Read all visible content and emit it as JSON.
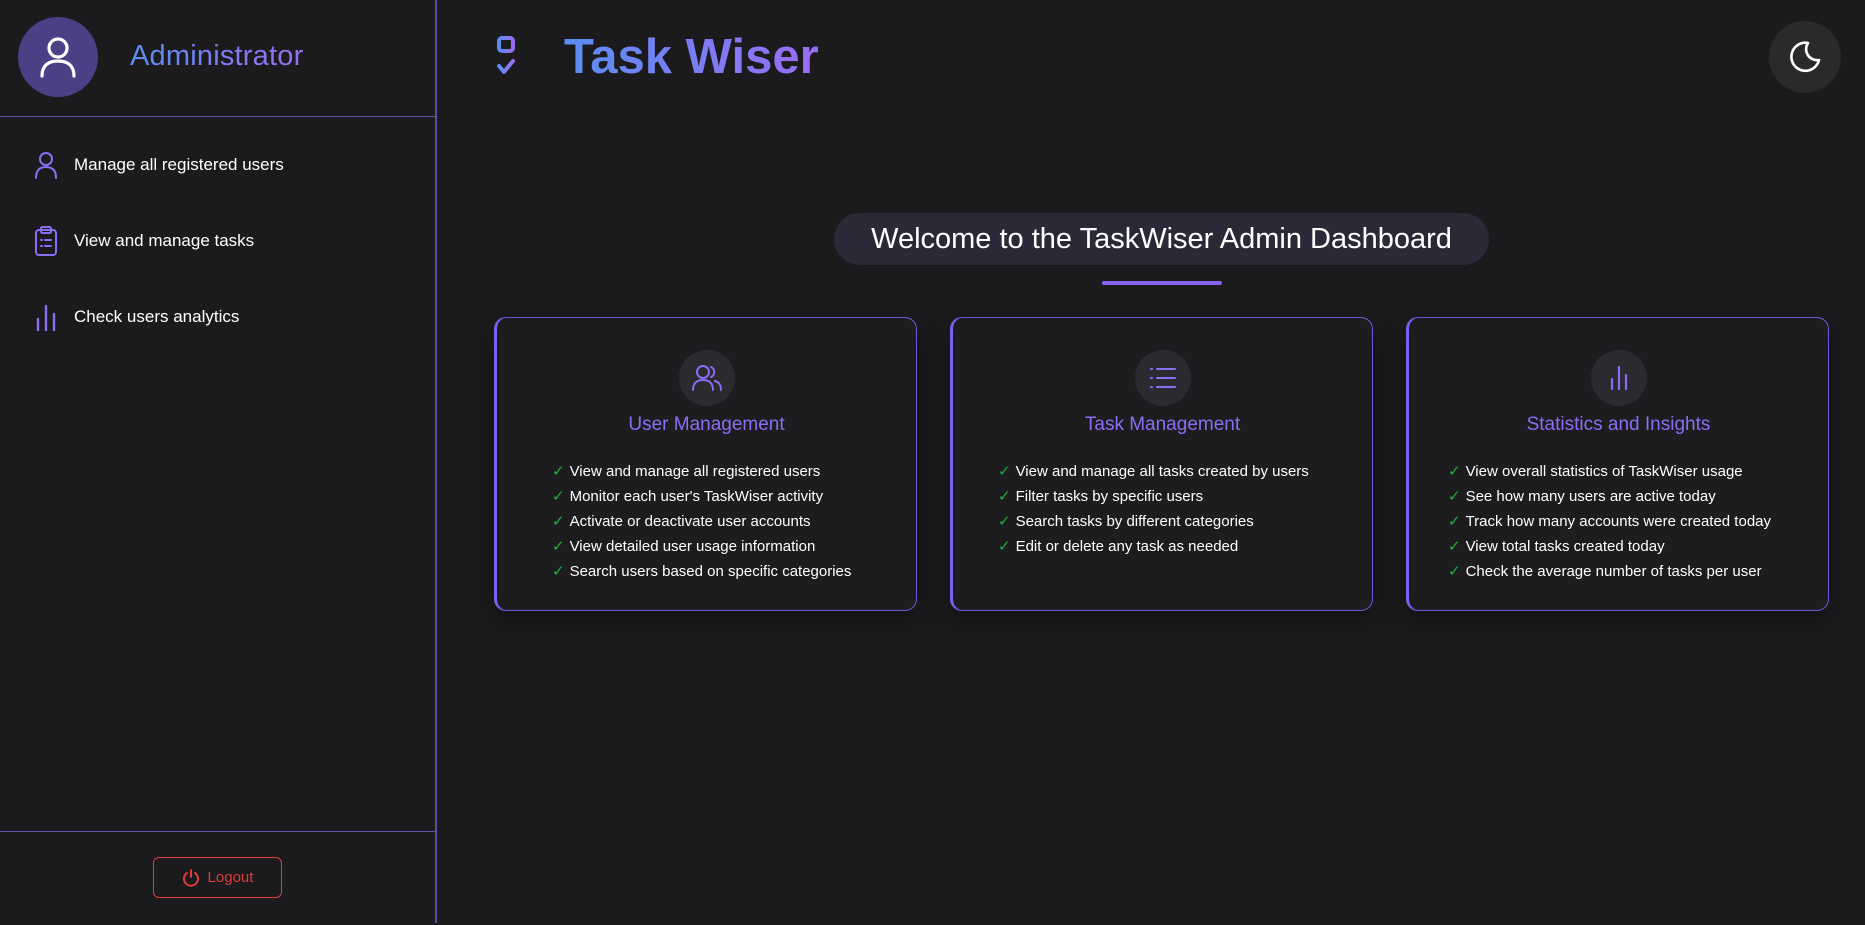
{
  "sidebar": {
    "user": {
      "name": "Administrator",
      "avatar_icon": "user-icon"
    },
    "items": [
      {
        "label": "Manage all registered users",
        "icon": "user-icon"
      },
      {
        "label": "View and manage tasks",
        "icon": "clipboard-list-icon"
      },
      {
        "label": "Check users analytics",
        "icon": "bar-chart-icon"
      }
    ],
    "logout": {
      "label": "Logout",
      "icon": "power-icon"
    }
  },
  "header": {
    "title": "Task Wiser",
    "logo_icon": "task-list-icon",
    "theme_toggle_icon": "moon-icon"
  },
  "main": {
    "welcome": "Welcome to the TaskWiser Admin Dashboard",
    "cards": [
      {
        "title": "User Management",
        "icon": "users-icon",
        "features": [
          "View and manage all registered users",
          "Monitor each user's TaskWiser activity",
          "Activate or deactivate user accounts",
          "View detailed user usage information",
          "Search users based on specific categories"
        ]
      },
      {
        "title": "Task Management",
        "icon": "list-icon",
        "features": [
          "View and manage all tasks created by users",
          "Filter tasks by specific users",
          "Search tasks by different categories",
          "Edit or delete any task as needed"
        ]
      },
      {
        "title": "Statistics and Insights",
        "icon": "bar-chart-icon",
        "features": [
          "View overall statistics of TaskWiser usage",
          "See how many users are active today",
          "Track how many accounts were created today",
          "View total tasks created today",
          "Check the average number of tasks per user"
        ]
      }
    ]
  },
  "colors": {
    "background": "#1b1b1d",
    "accent": "#8b6df5",
    "brand_gradient_start": "#5b8ef0",
    "brand_gradient_end": "#9a6cf5",
    "check": "#16b43a",
    "logout": "#e03b3b"
  }
}
